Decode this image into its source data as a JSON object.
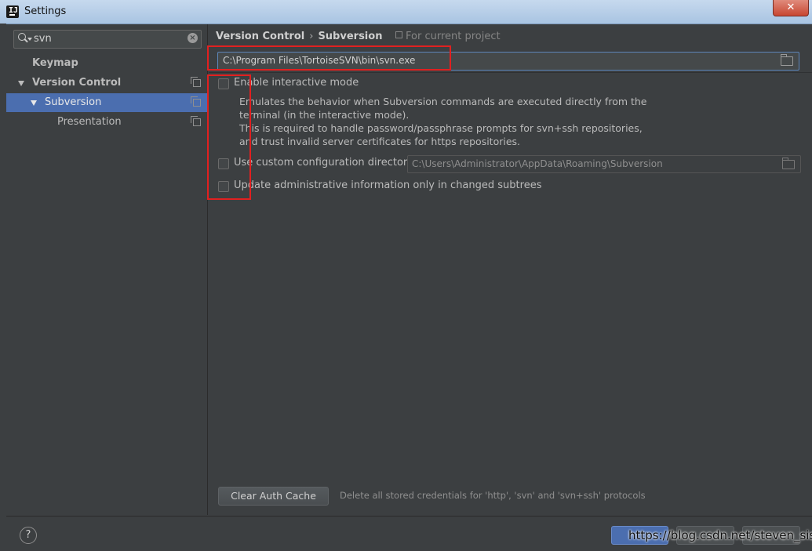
{
  "window": {
    "title": "Settings",
    "close_label": "✕"
  },
  "sidebar": {
    "search": {
      "value": "svn"
    },
    "items": [
      {
        "label": "Keymap"
      },
      {
        "label": "Version Control"
      },
      {
        "label": "Subversion"
      },
      {
        "label": "Presentation"
      }
    ]
  },
  "main": {
    "breadcrumb": {
      "parent": "Version Control",
      "separator": "›",
      "current": "Subversion"
    },
    "scope_label": "For current project",
    "svn_path": "C:\\Program Files\\TortoiseSVN\\bin\\svn.exe",
    "interactive": {
      "label": "Enable interactive mode",
      "checked": false,
      "description": [
        "Emulates the behavior when Subversion commands are executed directly from the",
        "terminal (in the interactive mode).",
        "This is required to handle password/passphrase prompts for svn+ssh repositories,",
        "and trust invalid server certificates for https repositories."
      ]
    },
    "custom_config": {
      "label": "Use custom configuration directory:",
      "checked": false,
      "path": "C:\\Users\\Administrator\\AppData\\Roaming\\Subversion"
    },
    "update_admin": {
      "label": "Update administrative information only in changed subtrees",
      "checked": false
    },
    "clear_cache": {
      "button_label": "Clear Auth Cache",
      "hint": "Delete all stored credentials for 'http', 'svn' and 'svn+ssh' protocols"
    }
  },
  "footer": {
    "help_label": "?",
    "watermark": "https://blog.csdn.net/steven_sisi"
  },
  "colors": {
    "selection": "#4b6eaf",
    "highlight": "#e12020",
    "background": "#3c3f41"
  }
}
